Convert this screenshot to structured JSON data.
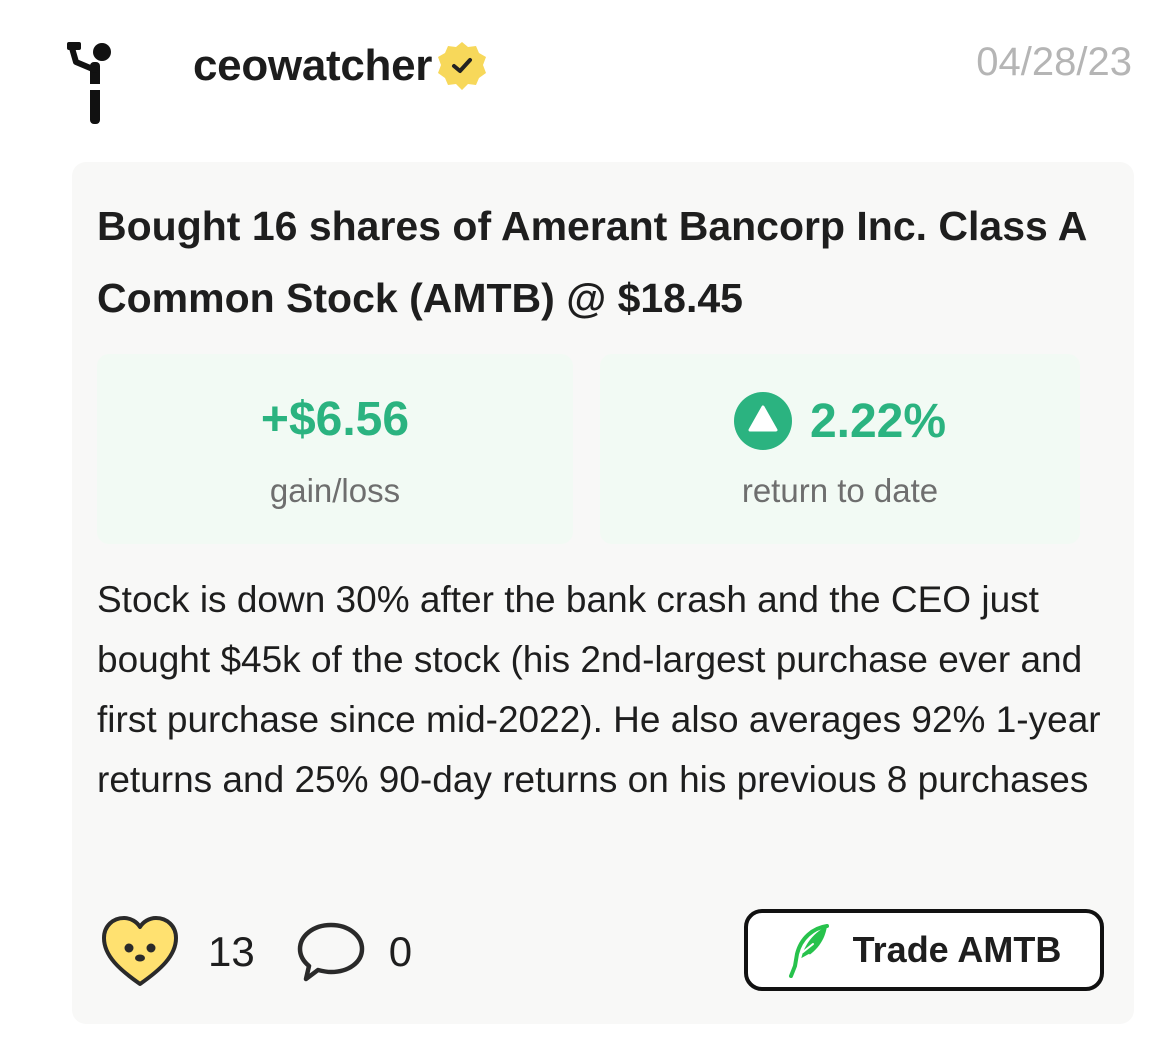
{
  "post": {
    "username": "ceowatcher",
    "date": "04/28/23",
    "title": "Bought 16 shares of Amerant Bancorp Inc. Class A Common Stock (AMTB) @ $18.45",
    "gain": {
      "value": "+$6.56",
      "label": "gain/loss"
    },
    "return": {
      "value": "2.22%",
      "label": "return to date"
    },
    "body": "Stock is down 30% after the bank crash and the CEO just bought $45k of the stock (his 2nd-largest purchase ever and first purchase since mid-2022). He also averages 92% 1-year returns and 25% 90-day returns on his previous 8 purchases",
    "likes": "13",
    "comments": "0",
    "trade_label": "Trade AMTB"
  },
  "icons": {
    "avatar": "person-drinking-icon",
    "verified": "verified-badge-icon",
    "return_direction": "up-triangle-icon",
    "like": "heart-face-icon",
    "comment": "speech-bubble-icon",
    "trade": "feather-icon"
  },
  "colors": {
    "positive": "#2bb380",
    "badge": "#f7d85a",
    "heart": "#ffe170",
    "feather": "#27c24c"
  }
}
